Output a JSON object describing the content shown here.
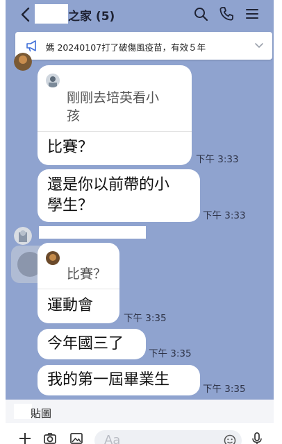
{
  "header": {
    "title": "之家",
    "member_count": "(5)",
    "icons": [
      "back-chevron-icon",
      "search-icon",
      "phone-icon",
      "menu-icon"
    ]
  },
  "announcement": {
    "icon": "megaphone-icon",
    "text": "媽 20240107打了破傷風疫苗，有效５年",
    "expand_icon": "chevron-down-icon"
  },
  "messages": [
    {
      "reply_to": "剛剛去培英看小孩",
      "text": "比賽？",
      "time": "下午 3:33"
    },
    {
      "text": "還是你以前帶的小學生？",
      "time": "下午 3:33"
    },
    {
      "reply_to": "比賽？",
      "text": "運動會",
      "time": "下午 3:35"
    },
    {
      "text": "今年國三了",
      "time": "下午 3:35"
    },
    {
      "text": "我的第一屆畢業生",
      "time": "下午 3:35"
    }
  ],
  "reply_lines": [
    "剛剛去培英看小",
    "孩"
  ],
  "text_lines_msg2": [
    "還是你以前帶的小",
    "學生？"
  ],
  "sticker_bar": {
    "label": "貼圖"
  },
  "input": {
    "placeholder": "Aa",
    "icons": [
      "plus-icon",
      "camera-icon",
      "image-icon",
      "emoji-icon",
      "mic-icon"
    ]
  },
  "colors": {
    "background": "#8fa3cf",
    "bubble": "#ffffff",
    "text": "#111111"
  }
}
